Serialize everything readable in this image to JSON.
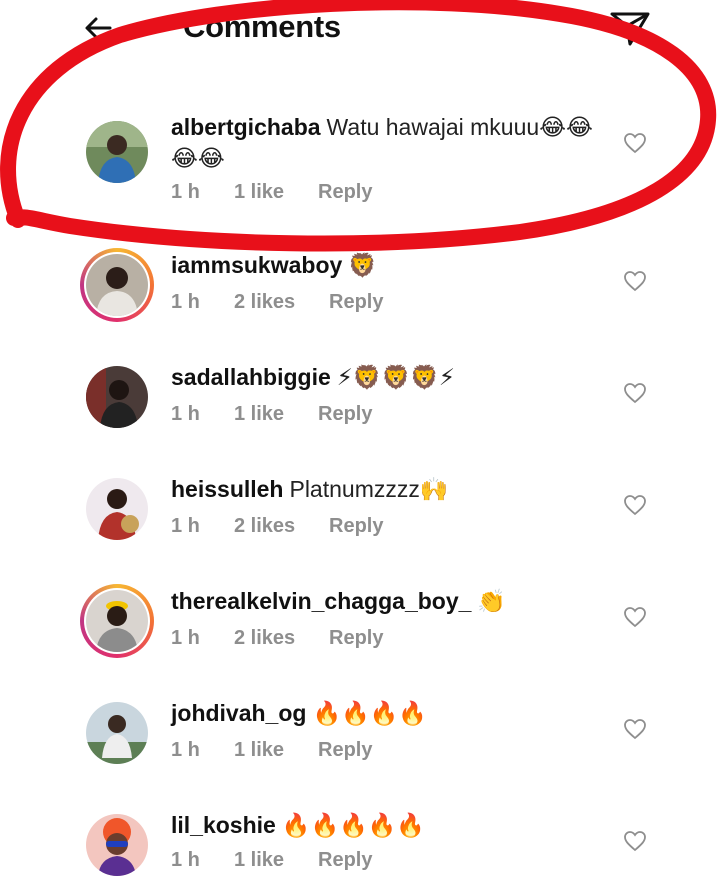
{
  "header": {
    "title": "Comments",
    "back_icon": "arrow-left-icon",
    "share_icon": "paper-plane-icon"
  },
  "comments": [
    {
      "username": "albertgichaba",
      "text": "Watu hawajai mkuuu😂😂😂😂",
      "time": "1 h",
      "likes": "1 like",
      "reply": "Reply",
      "story_ring": false
    },
    {
      "username": "iammsukwaboy",
      "text": "🦁",
      "time": "1 h",
      "likes": "2 likes",
      "reply": "Reply",
      "story_ring": true
    },
    {
      "username": "sadallahbiggie",
      "text": "⚡🦁🦁🦁⚡",
      "time": "1 h",
      "likes": "1 like",
      "reply": "Reply",
      "story_ring": false
    },
    {
      "username": "heissulleh",
      "text": "Platnumzzzz🙌",
      "time": "1 h",
      "likes": "2 likes",
      "reply": "Reply",
      "story_ring": false
    },
    {
      "username": "therealkelvin_chagga_boy_",
      "text": "👏",
      "time": "1 h",
      "likes": "2 likes",
      "reply": "Reply",
      "story_ring": true
    },
    {
      "username": "johdivah_og",
      "text": "🔥🔥🔥🔥",
      "time": "1 h",
      "likes": "1 like",
      "reply": "Reply",
      "story_ring": false
    },
    {
      "username": "lil_koshie",
      "text": "🔥🔥🔥🔥🔥",
      "time": "1 h",
      "likes": "1 like",
      "reply": "Reply",
      "story_ring": false
    }
  ],
  "colors": {
    "annotation_red": "#e8101a",
    "meta_grey": "#8e8e8e",
    "story_ring": "#e1306c"
  },
  "annotation": "red hand-drawn ellipse circling the first comment"
}
